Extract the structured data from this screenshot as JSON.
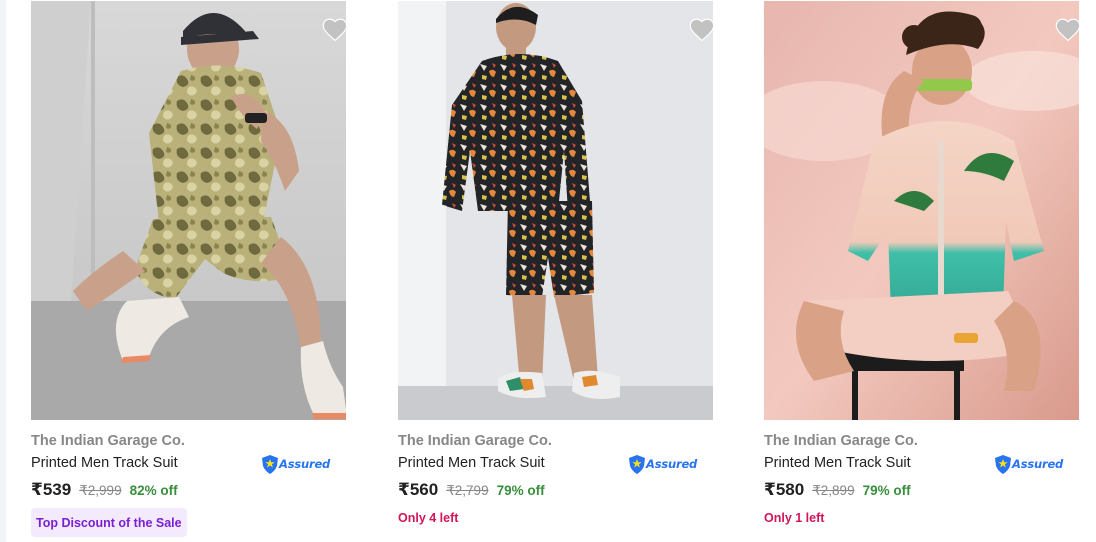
{
  "theme": {
    "brand_gray": "#878787",
    "title_color": "#212121",
    "discount_green": "#388e3c",
    "assured_blue": "#2874f0",
    "stock_red": "#d3145a",
    "promo_purple": "#7a1fd1",
    "promo_bg": "#f3eafe"
  },
  "products": [
    {
      "brand": "The Indian Garage Co.",
      "title": "Printed Men Track Suit",
      "assured_label": "Assured",
      "price": "₹539",
      "mrp": "₹2,999",
      "discount": "82% off",
      "promo": "Top Discount of the Sale",
      "wishlist_icon": "heart-icon"
    },
    {
      "brand": "The Indian Garage Co.",
      "title": "Printed Men Track Suit",
      "assured_label": "Assured",
      "price": "₹560",
      "mrp": "₹2,799",
      "discount": "79% off",
      "stock": "Only 4 left",
      "wishlist_icon": "heart-icon"
    },
    {
      "brand": "The Indian Garage Co.",
      "title": "Printed Men Track Suit",
      "assured_label": "Assured",
      "price": "₹580",
      "mrp": "₹2,899",
      "discount": "79% off",
      "stock": "Only 1 left",
      "wishlist_icon": "heart-icon"
    }
  ]
}
